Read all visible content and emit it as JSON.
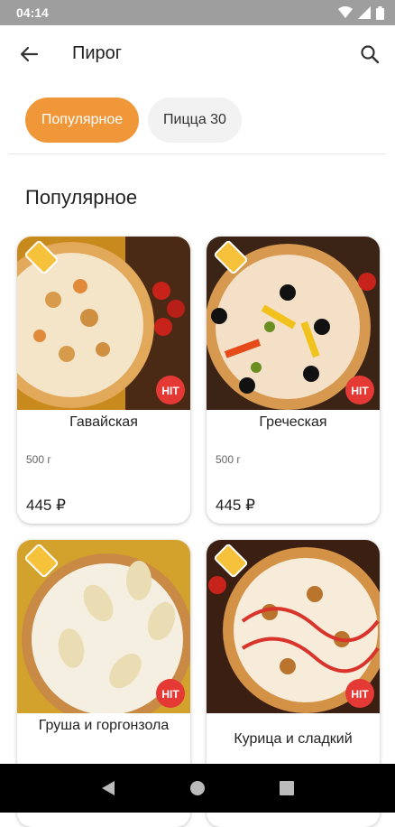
{
  "status_bar": {
    "time": "04:14",
    "icons": [
      "wifi-icon",
      "signal-icon",
      "battery-icon"
    ]
  },
  "topbar": {
    "title": "Пирог",
    "back_icon": "arrow-left-icon",
    "search_icon": "search-icon"
  },
  "chips": [
    {
      "label": "Популярное",
      "active": true
    },
    {
      "label": "Пицца 30",
      "active": false
    }
  ],
  "section": {
    "title": "Популярное"
  },
  "products": [
    {
      "name": "Гавайская",
      "weight": "500 г",
      "price": "445 ₽",
      "badge": "HIT",
      "tag_icon": "discount-tag-icon"
    },
    {
      "name": "Греческая",
      "weight": "500 г",
      "price": "445 ₽",
      "badge": "HIT",
      "tag_icon": "discount-tag-icon"
    },
    {
      "name": "Груша и горгонзола",
      "weight": "",
      "price": "",
      "badge": "HIT",
      "tag_icon": "discount-tag-icon"
    },
    {
      "name": "Курица и сладкий",
      "weight": "",
      "price": "",
      "badge": "HIT",
      "tag_icon": "discount-tag-icon"
    }
  ],
  "colors": {
    "accent": "#f0973a",
    "badge": "#e53935",
    "status_bar": "#9e9e9e",
    "nav_bar": "#000000"
  },
  "nav_bar": {
    "icons": [
      "back-triangle-icon",
      "home-circle-icon",
      "recents-square-icon"
    ]
  }
}
